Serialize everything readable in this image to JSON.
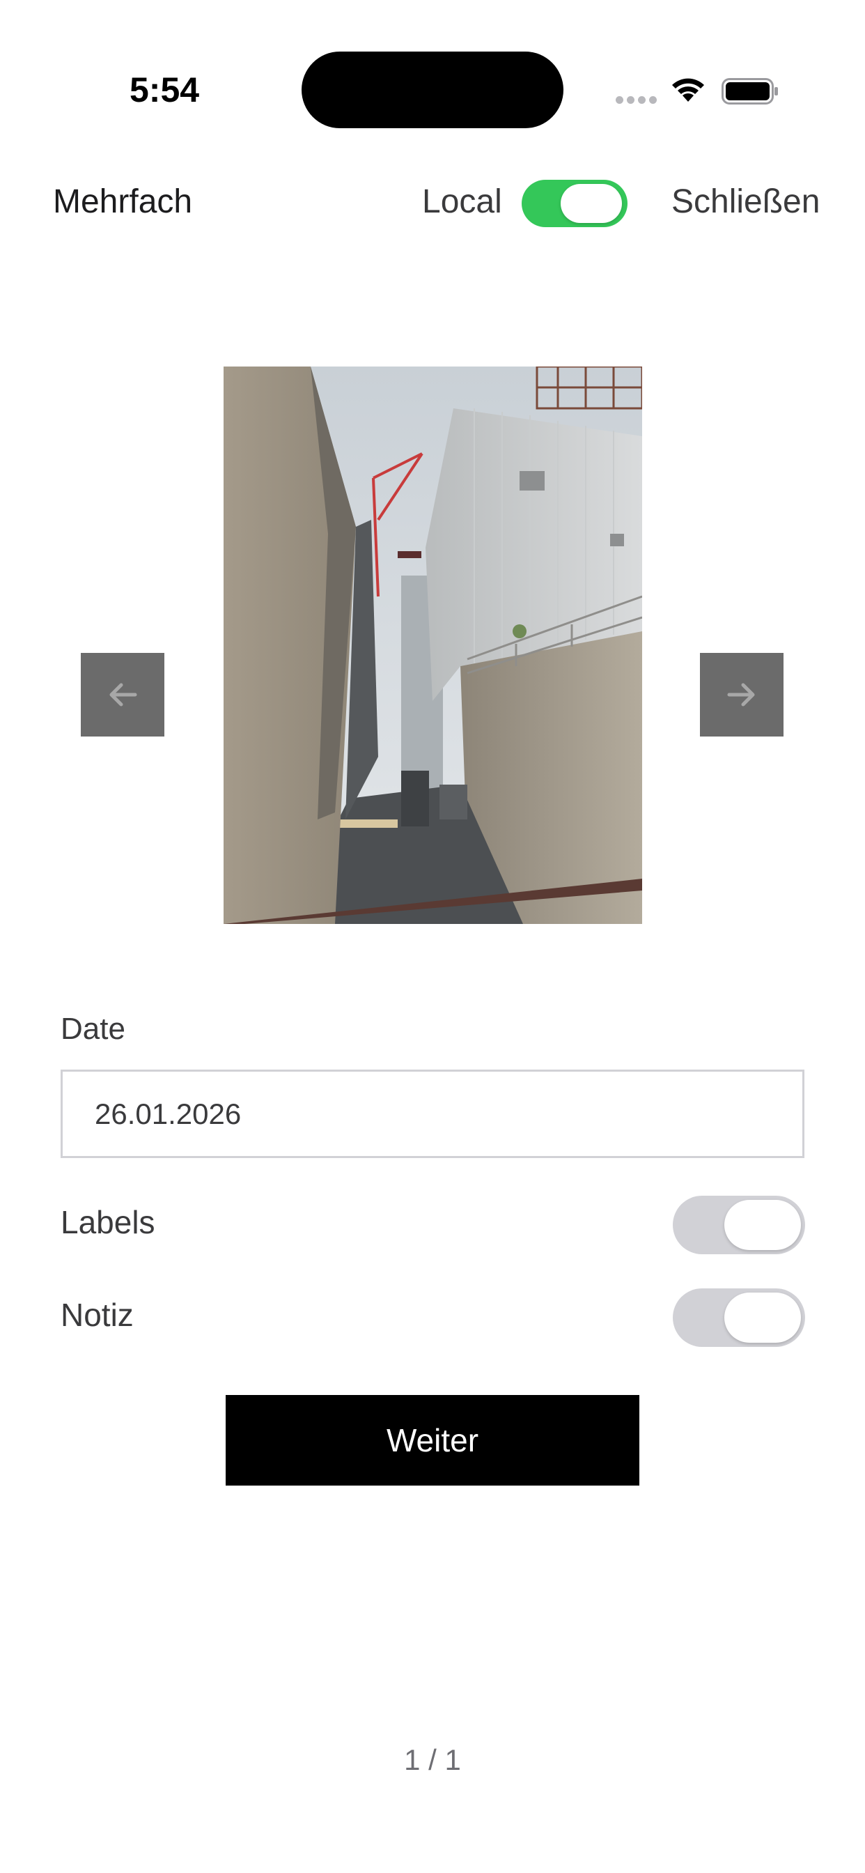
{
  "status_bar": {
    "time": "5:54"
  },
  "header": {
    "title": "Mehrfach",
    "local_label": "Local",
    "local_toggle_on": true,
    "close_label": "Schließen"
  },
  "photo_viewer": {
    "prev_icon": "arrow-left-icon",
    "next_icon": "arrow-right-icon"
  },
  "form": {
    "date_label": "Date",
    "date_value": "26.01.2026",
    "labels_label": "Labels",
    "labels_on": false,
    "notiz_label": "Notiz",
    "notiz_on": false
  },
  "actions": {
    "continue_label": "Weiter"
  },
  "pager": {
    "text": "1 / 1"
  },
  "colors": {
    "toggle_on": "#34c759",
    "toggle_off": "#d1d1d6",
    "nav_button": "#6b6b6b",
    "primary_button": "#000000"
  }
}
